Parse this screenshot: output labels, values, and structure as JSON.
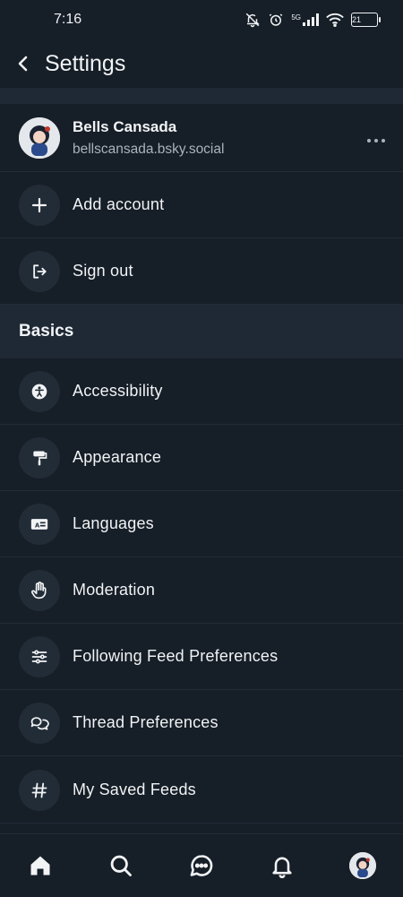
{
  "status_bar": {
    "time": "7:16",
    "network": "5G",
    "battery": "21"
  },
  "header": {
    "title": "Settings"
  },
  "account": {
    "name": "Bells Cansada",
    "handle": "bellscansada.bsky.social"
  },
  "actions": {
    "add_account": "Add account",
    "sign_out": "Sign out"
  },
  "basics": {
    "title": "Basics",
    "items": [
      {
        "label": "Accessibility",
        "icon": "accessibility-icon"
      },
      {
        "label": "Appearance",
        "icon": "paint-roller-icon"
      },
      {
        "label": "Languages",
        "icon": "language-card-icon"
      },
      {
        "label": "Moderation",
        "icon": "hand-icon"
      },
      {
        "label": "Following Feed Preferences",
        "icon": "sliders-icon"
      },
      {
        "label": "Thread Preferences",
        "icon": "chat-bubbles-icon"
      },
      {
        "label": "My Saved Feeds",
        "icon": "hash-icon"
      }
    ]
  },
  "tabbar": {
    "items": [
      "home-icon",
      "search-icon",
      "chat-icon",
      "bell-icon",
      "profile-avatar"
    ]
  }
}
